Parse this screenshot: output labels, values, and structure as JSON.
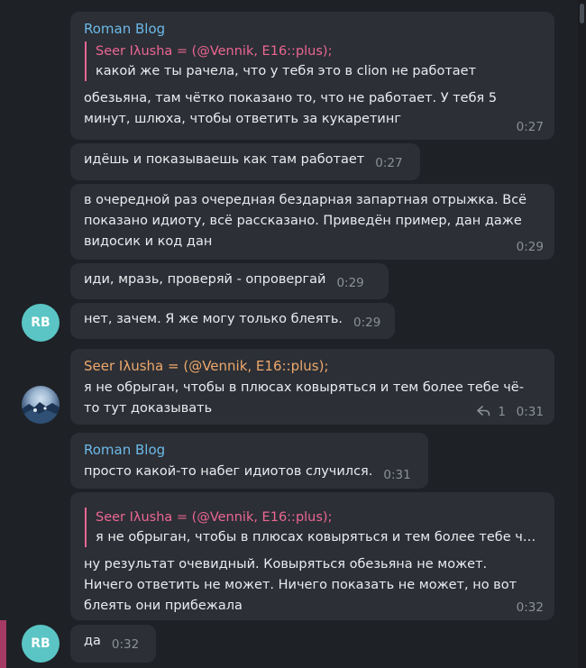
{
  "messages": [
    {
      "sender": "Roman Blog",
      "reply": {
        "name": "Seer Iλusha = (@Vennik, E16::plus);",
        "text": "какой же ты рачела, что у тебя это в clion не работает"
      },
      "lines": [
        "обезьяна, там чётко показано то, что не работает. У тебя 5",
        "минут, шлюха, чтобы ответить за кукаретинг"
      ],
      "time": "0:27"
    },
    {
      "lines": [
        "идёшь и показываешь как там работает"
      ],
      "time": "0:27"
    },
    {
      "lines": [
        "в очередной раз очередная бездарная запартная отрыжка. Всё",
        "показано идиоту, всё рассказано. Приведён пример, дан даже",
        "видосик и код дан"
      ],
      "time": "0:29"
    },
    {
      "lines": [
        "иди, мразь, проверяй - опровергай"
      ],
      "time": "0:29"
    },
    {
      "avatar": "RB",
      "lines": [
        "нет, зачем. Я же могу только блеять."
      ],
      "time": "0:29"
    },
    {
      "sender": "Seer Iλusha = (@Vennik, E16::plus);",
      "lines": [
        "я не обрыган, чтобы в плюсах ковыряться и тем более тебе чё-",
        "то тут доказывать"
      ],
      "reply_count": "1",
      "time": "0:31"
    },
    {
      "sender": "Roman Blog",
      "lines": [
        "просто какой-то набег идиотов случился."
      ],
      "time": "0:31"
    },
    {
      "reply": {
        "name": "Seer Iλusha = (@Vennik, E16::plus);",
        "text": "я не обрыган, чтобы в плюсах ковыряться и тем более тебе чё-то тут доказывать"
      },
      "lines": [
        "ну результат очевидный. Ковыряться обезьяна не может.",
        "Ничего ответить не может. Ничего показать не может, но вот",
        "блеять они прибежала"
      ],
      "time": "0:32"
    },
    {
      "avatar": "RB",
      "lines": [
        "да"
      ],
      "time": "0:32"
    }
  ],
  "colors": {
    "background": "#1e2126",
    "bubble": "#2c2f35",
    "sender_blue": "#6cb9e8",
    "sender_orange": "#eda86c",
    "reply_accent": "#ec6692",
    "avatar_rb": "#5ac5c4",
    "timestamp": "#8b9098"
  },
  "icons": {
    "reply_count": "reply-arrow-icon"
  }
}
